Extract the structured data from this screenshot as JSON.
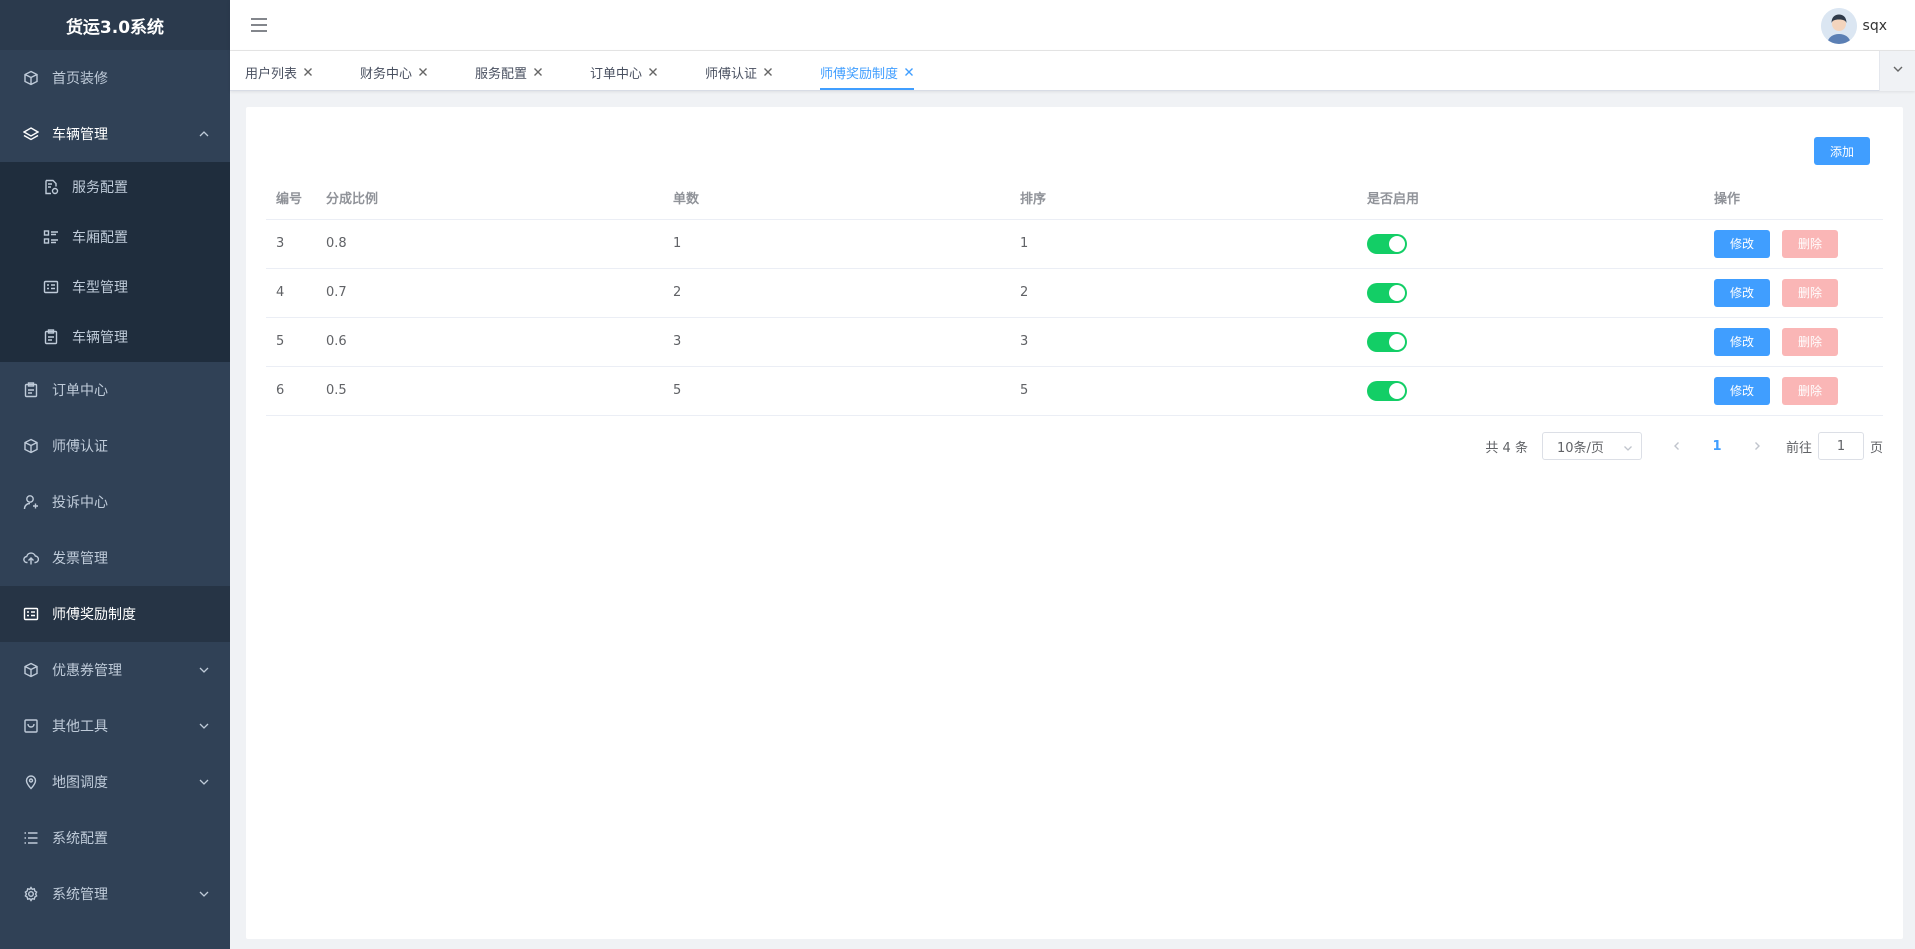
{
  "app_title": "货运3.0系统",
  "sidebar": {
    "items": [
      {
        "label": "首页装修",
        "icon": "cube-icon"
      },
      {
        "label": "车辆管理",
        "icon": "layers-icon",
        "expanded": true,
        "children": [
          {
            "label": "服务配置",
            "icon": "document-gear-icon"
          },
          {
            "label": "车厢配置",
            "icon": "list-icon"
          },
          {
            "label": "车型管理",
            "icon": "card-icon"
          },
          {
            "label": "车辆管理",
            "icon": "clipboard-icon"
          }
        ]
      },
      {
        "label": "订单中心",
        "icon": "clipboard-icon"
      },
      {
        "label": "师傅认证",
        "icon": "cube-icon"
      },
      {
        "label": "投诉中心",
        "icon": "user-icon"
      },
      {
        "label": "发票管理",
        "icon": "cloud-upload-icon"
      },
      {
        "label": "师傅奖励制度",
        "icon": "card-icon",
        "active": true
      },
      {
        "label": "优惠券管理",
        "icon": "cube-icon",
        "has_children": true
      },
      {
        "label": "其他工具",
        "icon": "box-icon",
        "has_children": true
      },
      {
        "label": "地图调度",
        "icon": "map-pin-icon",
        "has_children": true
      },
      {
        "label": "系统配置",
        "icon": "list-lines-icon"
      },
      {
        "label": "系统管理",
        "icon": "gear-icon",
        "has_children": true
      }
    ]
  },
  "header": {
    "username": "sqx"
  },
  "tags": [
    {
      "label": "用户列表"
    },
    {
      "label": "财务中心"
    },
    {
      "label": "服务配置"
    },
    {
      "label": "订单中心"
    },
    {
      "label": "师傅认证"
    },
    {
      "label": "师傅奖励制度",
      "active": true
    }
  ],
  "toolbar": {
    "add_label": "添加"
  },
  "table": {
    "columns": [
      "编号",
      "分成比例",
      "单数",
      "排序",
      "是否启用",
      "操作"
    ],
    "rows": [
      {
        "id": "3",
        "ratio": "0.8",
        "count": "1",
        "sort": "1",
        "enabled": true
      },
      {
        "id": "4",
        "ratio": "0.7",
        "count": "2",
        "sort": "2",
        "enabled": true
      },
      {
        "id": "5",
        "ratio": "0.6",
        "count": "3",
        "sort": "3",
        "enabled": true
      },
      {
        "id": "6",
        "ratio": "0.5",
        "count": "5",
        "sort": "5",
        "enabled": true
      }
    ],
    "edit_label": "修改",
    "delete_label": "删除"
  },
  "pagination": {
    "total_text": "共 4 条",
    "page_size": "10条/页",
    "current_page": "1",
    "goto_label": "前往",
    "goto_value": "1",
    "page_suffix": "页"
  },
  "colors": {
    "sidebar_bg": "#304156",
    "primary": "#409eff",
    "switch_on": "#13ce66",
    "danger_disabled": "#fab6b6"
  }
}
